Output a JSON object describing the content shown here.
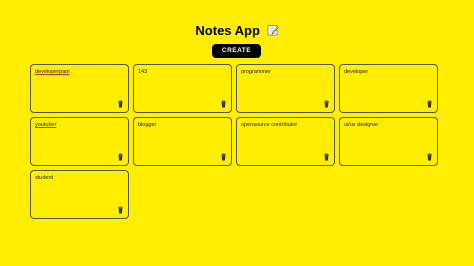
{
  "header": {
    "title": "Notes App",
    "title_icon": "memo-pencil-icon",
    "create_label": "CREATE"
  },
  "notes": [
    {
      "text": "developerpani",
      "spellcheck_underline": true
    },
    {
      "text": "143",
      "spellcheck_underline": false
    },
    {
      "text": "programmer",
      "spellcheck_underline": false
    },
    {
      "text": "developer",
      "spellcheck_underline": false
    },
    {
      "text": "youtuber",
      "spellcheck_underline": true
    },
    {
      "text": "blogger",
      "spellcheck_underline": false
    },
    {
      "text": "opensource contributor",
      "spellcheck_underline": false
    },
    {
      "text": "ui/ux designer",
      "spellcheck_underline": false
    },
    {
      "text": "student",
      "spellcheck_underline": false
    }
  ],
  "colors": {
    "background": "#ffee00",
    "button": "#000000",
    "button_text": "#ffffff",
    "card_border": "#555555",
    "spellcheck": "#c0392b"
  },
  "icons": {
    "delete": "trash-icon"
  }
}
